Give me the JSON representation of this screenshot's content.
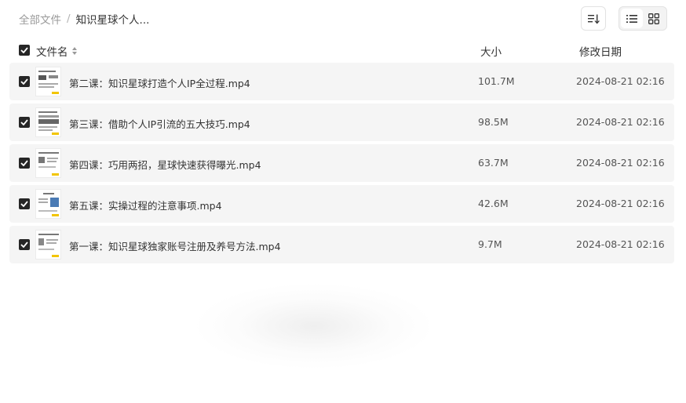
{
  "breadcrumb": {
    "root": "全部文件",
    "separator": "/",
    "current": "知识星球个人..."
  },
  "toolbar": {
    "sort_icon": "sort-icon",
    "view_modes": [
      "list-view-icon",
      "grid-view-icon"
    ]
  },
  "table": {
    "headers": {
      "name": "文件名",
      "size": "大小",
      "date": "修改日期"
    },
    "select_all_checked": true
  },
  "files": [
    {
      "name": "第二课：知识星球打造个人IP全过程.mp4",
      "size": "101.7M",
      "date": "2024-08-21 02:16",
      "checked": true
    },
    {
      "name": "第三课：借助个人IP引流的五大技巧.mp4",
      "size": "98.5M",
      "date": "2024-08-21 02:16",
      "checked": true
    },
    {
      "name": "第四课：巧用两招，星球快速获得曝光.mp4",
      "size": "63.7M",
      "date": "2024-08-21 02:16",
      "checked": true
    },
    {
      "name": "第五课：实操过程的注意事项.mp4",
      "size": "42.6M",
      "date": "2024-08-21 02:16",
      "checked": true
    },
    {
      "name": "第一课：知识星球独家账号注册及养号方法.mp4",
      "size": "9.7M",
      "date": "2024-08-21 02:16",
      "checked": true
    }
  ],
  "colors": {
    "row_background": "#f5f5f5",
    "checkbox": "#262626",
    "breadcrumb_root": "#9a9a9a"
  }
}
